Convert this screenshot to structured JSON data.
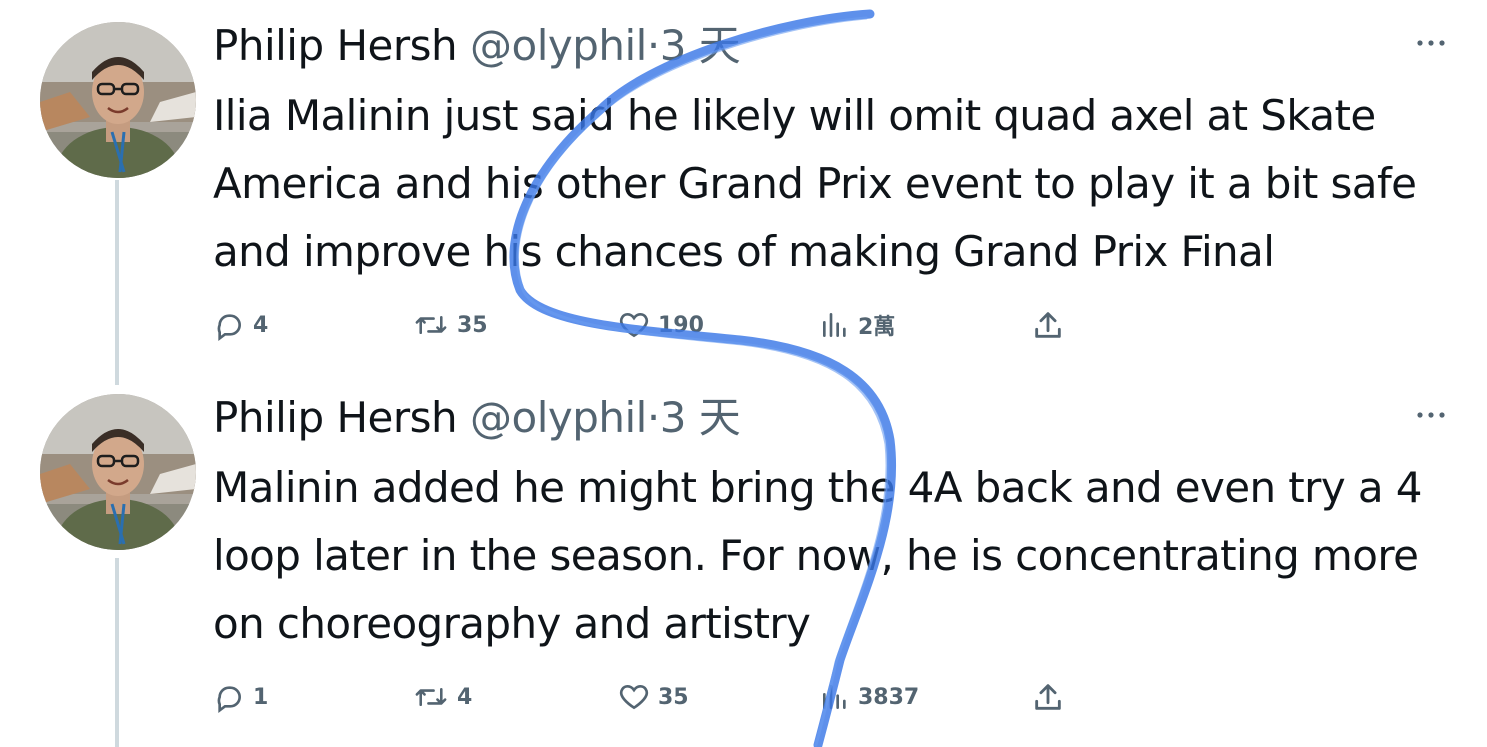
{
  "tweets": [
    {
      "name": "Philip Hersh",
      "handle": "@olyphil",
      "separator": "·",
      "time": "3 天",
      "text": "Ilia Malinin just said he likely will omit quad axel at Skate America and his other Grand Prix event to play it a bit safe and improve his chances of making Grand Prix Final",
      "replies": "4",
      "retweets": "35",
      "likes": "190",
      "views": "2萬"
    },
    {
      "name": "Philip Hersh",
      "handle": "@olyphil",
      "separator": "·",
      "time": "3 天",
      "text": "Malinin added he might bring the 4A back and even try a 4 loop later in the season. For now, he is concentrating more on choreography and artistry",
      "replies": "1",
      "retweets": "4",
      "likes": "35",
      "views": "3837"
    }
  ],
  "icons": {
    "more": "more-horizontal-icon",
    "reply": "reply-icon",
    "retweet": "retweet-icon",
    "like": "heart-icon",
    "views": "views-chart-icon",
    "share": "share-icon"
  },
  "colors": {
    "text": "#0f1419",
    "secondary": "#536471",
    "thread_line": "#cfd9de",
    "scribble": "#3b78e7"
  }
}
